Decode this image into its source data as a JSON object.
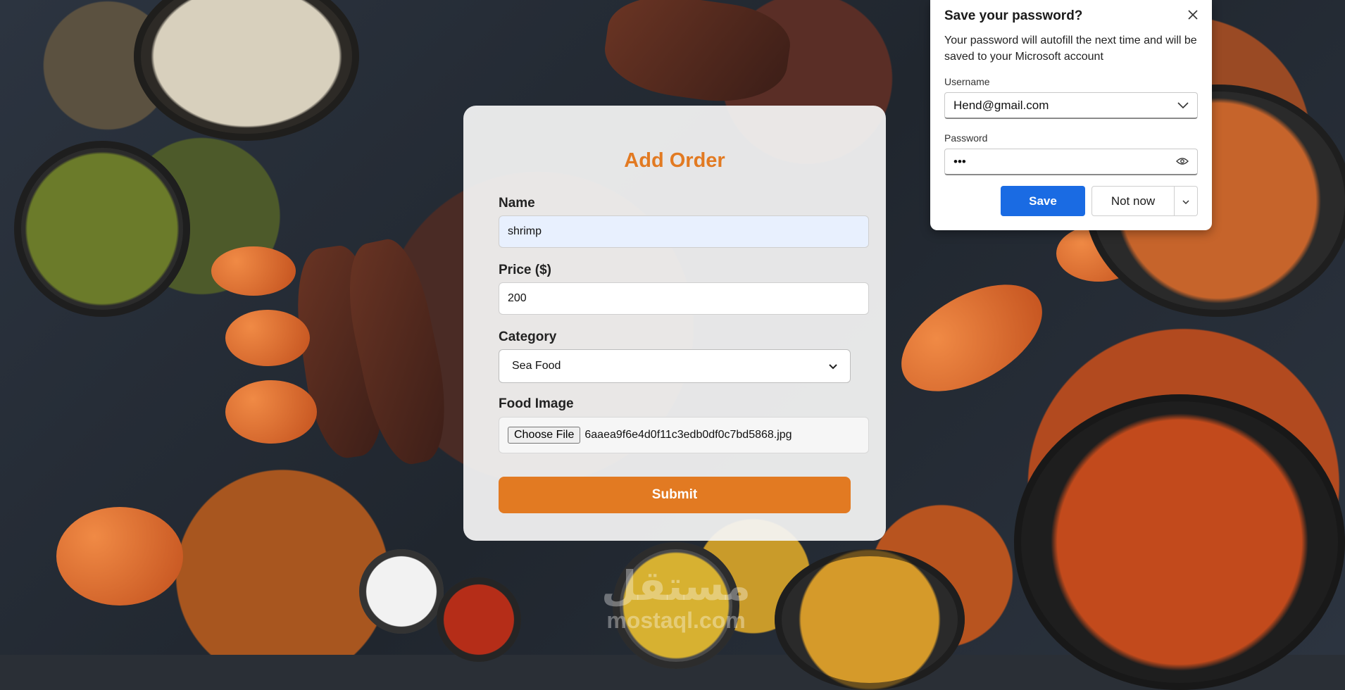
{
  "form": {
    "title": "Add Order",
    "name_label": "Name",
    "name_value": "shrimp",
    "price_label": "Price ($)",
    "price_value": "200",
    "category_label": "Category",
    "category_value": "Sea Food",
    "image_label": "Food Image",
    "choose_file_label": "Choose File",
    "file_name": "6aaea9f6e4d0f11c3edb0df0c7bd5868.jpg",
    "submit_label": "Submit"
  },
  "password_prompt": {
    "title": "Save your password?",
    "description": "Your password will autofill the next time and will be saved to your Microsoft account",
    "username_label": "Username",
    "username_value": "Hend@gmail.com",
    "password_label": "Password",
    "password_value": "•••",
    "save_label": "Save",
    "not_now_label": "Not now"
  },
  "watermark": {
    "arabic": "مستقل",
    "latin": "mostaql.com"
  },
  "colors": {
    "accent": "#e27a22",
    "primary_button": "#1a6be3"
  },
  "icons": {
    "close": "close-icon",
    "dropdown": "chevron-down-icon",
    "reveal": "eye-icon"
  }
}
